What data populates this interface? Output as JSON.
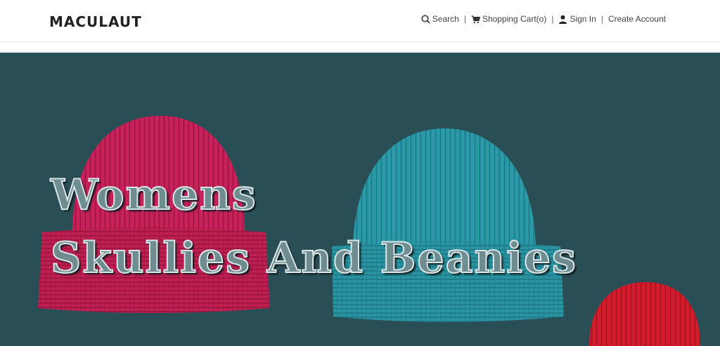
{
  "brand": "MACULAUT",
  "nav": {
    "search": "Search",
    "cart": "Shopping Cart(o)",
    "sign_in": "Sign In",
    "create_account": "Create Account",
    "separator": "|"
  },
  "hero": {
    "line1": "Womens",
    "line2": "Skullies And  Beanies",
    "background_color": "#2a4e56",
    "hat_colors": [
      "#c8225a",
      "#2b9aa8",
      "#d21c2c"
    ]
  }
}
